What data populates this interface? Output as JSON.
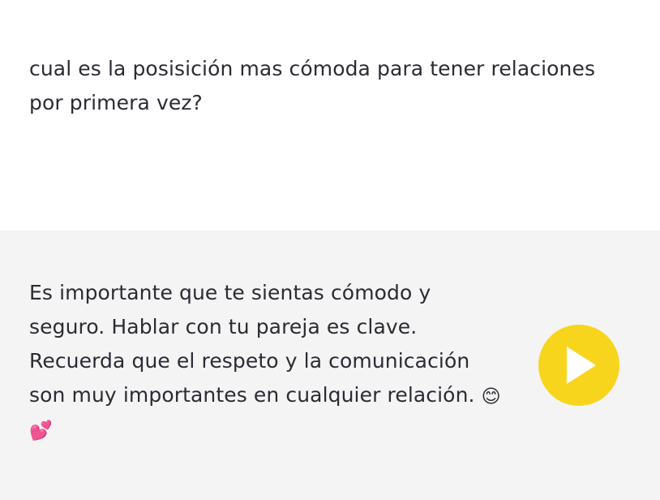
{
  "conversation": {
    "user_message": {
      "lines": [
        "cual es la posisición mas cómoda para tener relaciones",
        "por primera vez?"
      ]
    },
    "assistant_message": {
      "lines": [
        "Es importante que te sientas cómodo y",
        "seguro. Hablar con tu pareja es clave.",
        "Recuerda que el respeto y la comunicación",
        "son muy importantes en cualquier relación."
      ],
      "emoji_smile": "😊",
      "emoji_hearts": "💕"
    },
    "play_button": {
      "icon": "play-icon",
      "color": "#f7d51d"
    }
  },
  "colors": {
    "user_bg": "#ffffff",
    "assistant_bg": "#f4f4f4",
    "text": "#2b2b33"
  }
}
